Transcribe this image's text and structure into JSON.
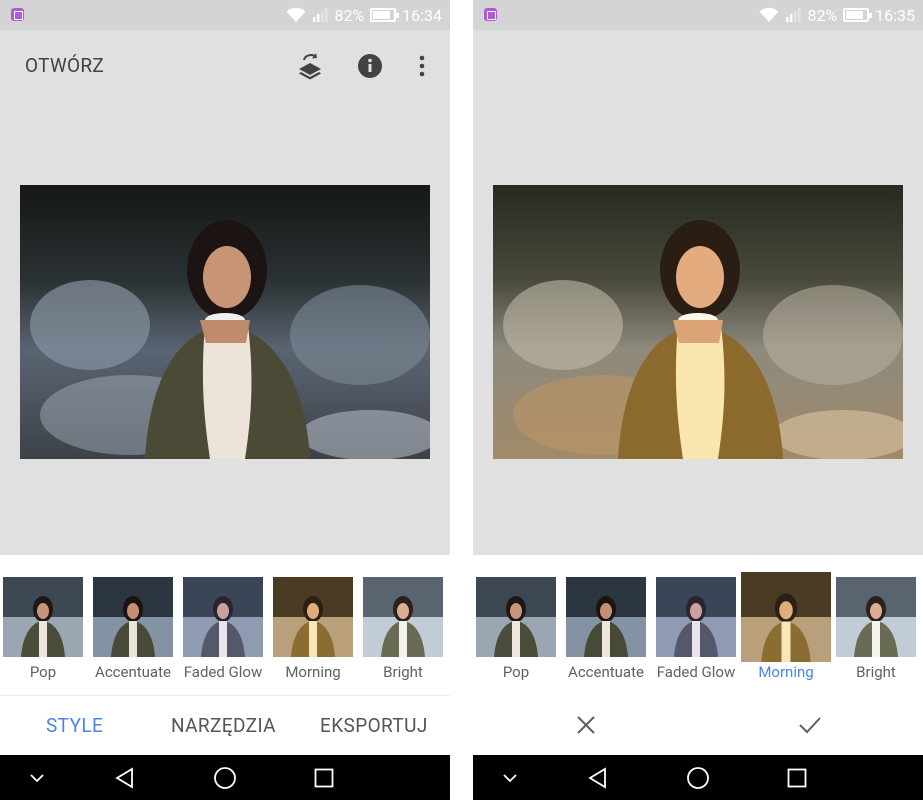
{
  "screens": [
    {
      "status": {
        "battery": "82%",
        "time": "16:34"
      },
      "open_label": "OTWÓRZ",
      "icons": [
        "layers-refresh-icon",
        "info-icon",
        "more-vert-icon"
      ],
      "filters": [
        {
          "label": "Pop",
          "selected": false
        },
        {
          "label": "Accentuate",
          "selected": false
        },
        {
          "label": "Faded Glow",
          "selected": false
        },
        {
          "label": "Morning",
          "selected": false
        },
        {
          "label": "Bright",
          "selected": false
        }
      ],
      "tabs": [
        {
          "label": "STYLE",
          "active": true
        },
        {
          "label": "NARZĘDZIA",
          "active": false
        },
        {
          "label": "EKSPORTUJ",
          "active": false
        }
      ]
    },
    {
      "status": {
        "battery": "82%",
        "time": "16:35"
      },
      "filters": [
        {
          "label": "Pop",
          "selected": false
        },
        {
          "label": "Accentuate",
          "selected": false
        },
        {
          "label": "Faded Glow",
          "selected": false
        },
        {
          "label": "Morning",
          "selected": true
        },
        {
          "label": "Bright",
          "selected": false
        }
      ],
      "actions": [
        "close-icon",
        "check-icon"
      ]
    }
  ],
  "colors": {
    "accent": "#4a86e8",
    "background": "#e0e0e0",
    "statusbar": "#d4d4d4"
  }
}
